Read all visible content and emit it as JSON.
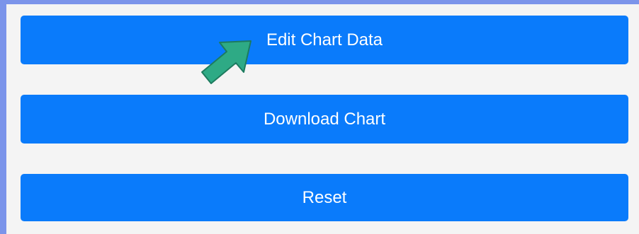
{
  "buttons": {
    "edit_chart_data": "Edit Chart Data",
    "download_chart": "Download Chart",
    "reset": "Reset"
  },
  "colors": {
    "page_border": "#7b94ea",
    "panel_background": "#f4f4f4",
    "button_background": "#0a7bfb",
    "button_text": "#ffffff",
    "arrow_fill": "#2eaa85",
    "arrow_stroke": "#1d7b5e"
  },
  "icons": {
    "annotation": "pointer-arrow-icon"
  }
}
